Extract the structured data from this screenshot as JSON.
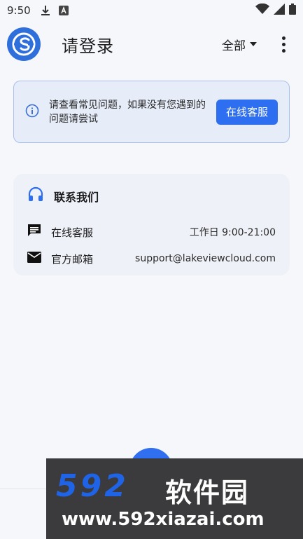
{
  "status_bar": {
    "time": "9:50"
  },
  "app_bar": {
    "title": "请登录",
    "filter_label": "全部"
  },
  "notice": {
    "text": "请查看常见问题，如果没有您遇到的问题请尝试",
    "button_label": "在线客服"
  },
  "contact": {
    "title": "联系我们",
    "rows": [
      {
        "label": "在线客服",
        "value": "工作日 9:00-21:00"
      },
      {
        "label": "官方邮箱",
        "value": "support@lakeviewcloud.com"
      }
    ]
  },
  "watermark": {
    "brand": "592",
    "brand_cn": "软件园",
    "url": "www.592xiazai.com"
  },
  "colors": {
    "accent": "#2e6ff2",
    "notice_bg": "#e6edf9",
    "card_bg": "#eef1f7"
  }
}
